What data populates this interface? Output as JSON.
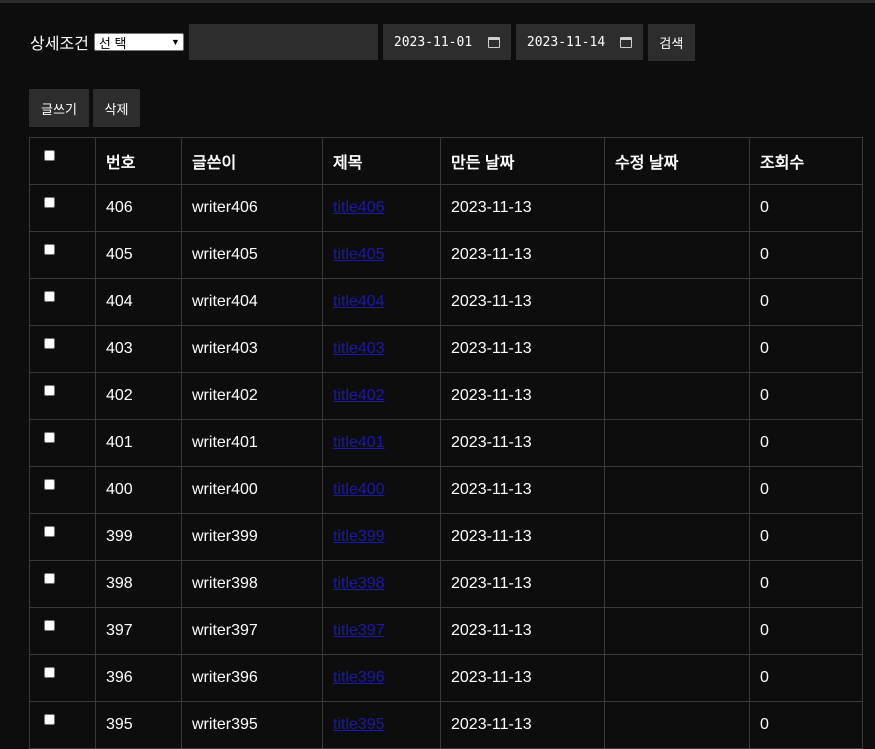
{
  "search": {
    "label": "상세조건",
    "select_value": "선 택",
    "keyword_value": "",
    "date_from": "2023-11-01",
    "date_to": "2023-11-14",
    "search_button": "검색"
  },
  "actions": {
    "write_button": "글쓰기",
    "delete_button": "삭제"
  },
  "table": {
    "headers": {
      "number": "번호",
      "writer": "글쓴이",
      "title": "제목",
      "created": "만든 날짜",
      "modified": "수정 날짜",
      "views": "조회수"
    },
    "rows": [
      {
        "number": "406",
        "writer": "writer406",
        "title": "title406",
        "created": "2023-11-13",
        "modified": "",
        "views": "0"
      },
      {
        "number": "405",
        "writer": "writer405",
        "title": "title405",
        "created": "2023-11-13",
        "modified": "",
        "views": "0"
      },
      {
        "number": "404",
        "writer": "writer404",
        "title": "title404",
        "created": "2023-11-13",
        "modified": "",
        "views": "0"
      },
      {
        "number": "403",
        "writer": "writer403",
        "title": "title403",
        "created": "2023-11-13",
        "modified": "",
        "views": "0"
      },
      {
        "number": "402",
        "writer": "writer402",
        "title": "title402",
        "created": "2023-11-13",
        "modified": "",
        "views": "0"
      },
      {
        "number": "401",
        "writer": "writer401",
        "title": "title401",
        "created": "2023-11-13",
        "modified": "",
        "views": "0"
      },
      {
        "number": "400",
        "writer": "writer400",
        "title": "title400",
        "created": "2023-11-13",
        "modified": "",
        "views": "0"
      },
      {
        "number": "399",
        "writer": "writer399",
        "title": "title399",
        "created": "2023-11-13",
        "modified": "",
        "views": "0"
      },
      {
        "number": "398",
        "writer": "writer398",
        "title": "title398",
        "created": "2023-11-13",
        "modified": "",
        "views": "0"
      },
      {
        "number": "397",
        "writer": "writer397",
        "title": "title397",
        "created": "2023-11-13",
        "modified": "",
        "views": "0"
      },
      {
        "number": "396",
        "writer": "writer396",
        "title": "title396",
        "created": "2023-11-13",
        "modified": "",
        "views": "0"
      },
      {
        "number": "395",
        "writer": "writer395",
        "title": "title395",
        "created": "2023-11-13",
        "modified": "",
        "views": "0"
      }
    ]
  },
  "colors": {
    "background": "#0d0d0d",
    "control": "#2d2d2d",
    "border": "#3a3a3a",
    "link": "#1a1aa6"
  }
}
